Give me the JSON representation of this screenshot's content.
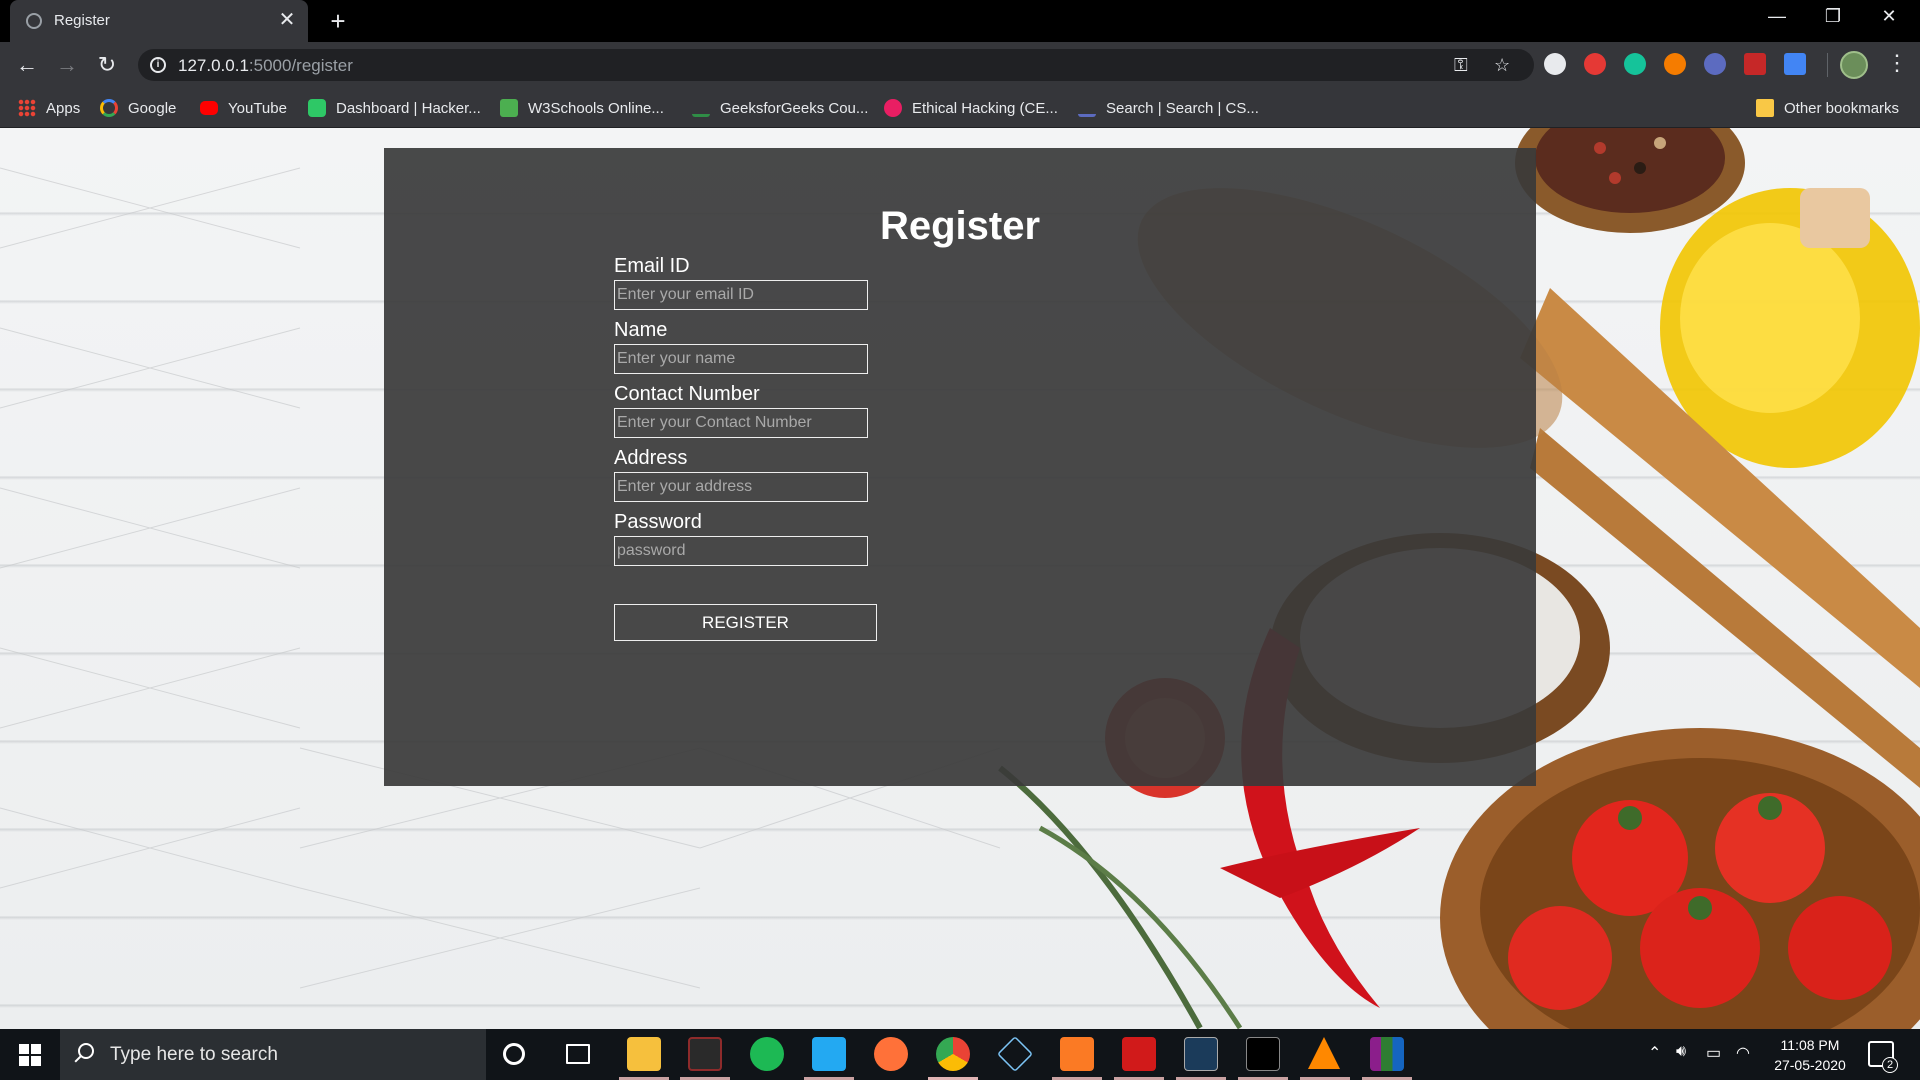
{
  "browser": {
    "tab_title": "Register",
    "url_host": "127.0.0.1",
    "url_path": ":5000/register",
    "bookmarks": [
      {
        "label": "Apps",
        "icon": "apps-grid-icon"
      },
      {
        "label": "Google",
        "icon": "google-icon"
      },
      {
        "label": "YouTube",
        "icon": "youtube-icon"
      },
      {
        "label": "Dashboard | Hacker...",
        "icon": "hackerrank-icon"
      },
      {
        "label": "W3Schools Online...",
        "icon": "w3schools-icon"
      },
      {
        "label": "GeeksforGeeks Cou...",
        "icon": "geeksforgeeks-icon"
      },
      {
        "label": "Ethical Hacking (CE...",
        "icon": "ethical-hacking-icon"
      },
      {
        "label": "Search | Search | CS...",
        "icon": "search-cs-icon"
      }
    ],
    "other_bookmarks": "Other bookmarks"
  },
  "page": {
    "title": "Register",
    "fields": [
      {
        "label": "Email ID",
        "placeholder": "Enter your email ID"
      },
      {
        "label": "Name",
        "placeholder": "Enter your name"
      },
      {
        "label": "Contact Number",
        "placeholder": "Enter your Contact Number"
      },
      {
        "label": "Address",
        "placeholder": "Enter your address"
      },
      {
        "label": "Password",
        "placeholder": "password"
      }
    ],
    "submit_label": "REGISTER"
  },
  "taskbar": {
    "search_placeholder": "Type here to search",
    "time": "11:08 PM",
    "date": "27-05-2020",
    "notification_count": "2"
  },
  "colors": {
    "panel": "#3a3a3a",
    "chrome_dark": "#35363a",
    "taskbar": "#101418"
  }
}
